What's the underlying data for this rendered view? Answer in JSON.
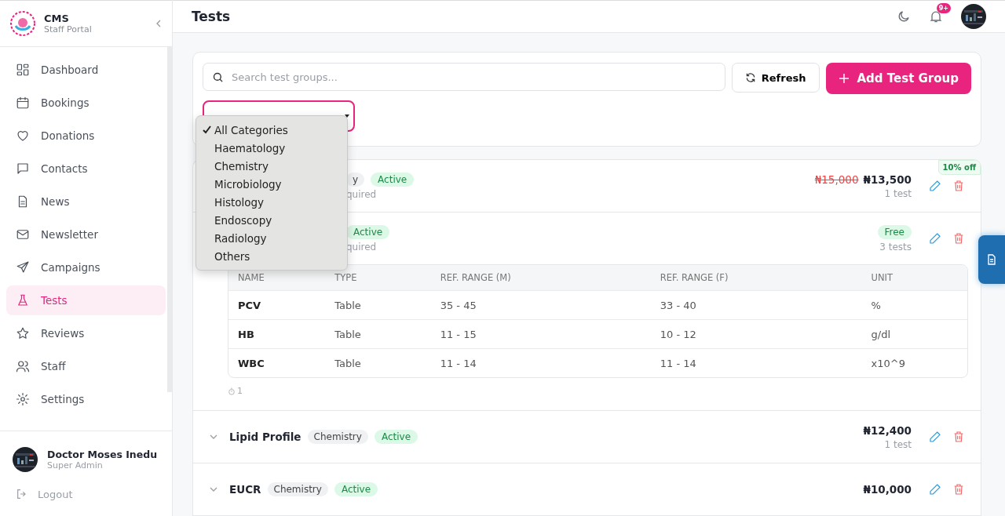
{
  "sidebar": {
    "brand": {
      "title": "CMS",
      "subtitle": "Staff Portal"
    },
    "items": [
      {
        "label": "Dashboard",
        "selected": false
      },
      {
        "label": "Bookings",
        "selected": false
      },
      {
        "label": "Donations",
        "selected": false
      },
      {
        "label": "Contacts",
        "selected": false
      },
      {
        "label": "News",
        "selected": false
      },
      {
        "label": "Newsletter",
        "selected": false
      },
      {
        "label": "Campaigns",
        "selected": false
      },
      {
        "label": "Tests",
        "selected": true
      },
      {
        "label": "Reviews",
        "selected": false
      },
      {
        "label": "Staff",
        "selected": false
      },
      {
        "label": "Settings",
        "selected": false
      }
    ],
    "user": {
      "name": "Doctor Moses Inedu",
      "role": "Super Admin"
    },
    "logout": "Logout"
  },
  "header": {
    "title": "Tests",
    "notification_badge": "9+"
  },
  "toolbar": {
    "search_placeholder": "Search test groups...",
    "refresh": "Refresh",
    "add": "Add Test Group"
  },
  "category_dropdown": {
    "options": [
      {
        "label": "All Categories",
        "selected": true
      },
      {
        "label": "Haematology",
        "selected": false
      },
      {
        "label": "Chemistry",
        "selected": false
      },
      {
        "label": "Microbiology",
        "selected": false
      },
      {
        "label": "Histology",
        "selected": false
      },
      {
        "label": "Endoscopy",
        "selected": false
      },
      {
        "label": "Radiology",
        "selected": false
      },
      {
        "label": "Others",
        "selected": false
      }
    ]
  },
  "groups": [
    {
      "category": "y",
      "status": "Active",
      "subtitle": "quired",
      "old_price": "₦15,000",
      "price": "₦13,500",
      "discount": "10% off",
      "count": "1 test",
      "expanded": false
    },
    {
      "status": "Active",
      "subtitle": "quired",
      "price_badge": "Free",
      "count": "3 tests",
      "expanded": true,
      "table": {
        "columns": [
          "NAME",
          "TYPE",
          "REF. RANGE (M)",
          "REF. RANGE (F)",
          "UNIT"
        ],
        "rows": [
          [
            "PCV",
            "Table",
            "35 - 45",
            "33 - 40",
            "%"
          ],
          [
            "HB",
            "Table",
            "11 - 15",
            "10 - 12",
            "g/dl"
          ],
          [
            "WBC",
            "Table",
            "11 - 14",
            "11 - 14",
            "x10^9"
          ]
        ]
      },
      "footer": "1"
    },
    {
      "name": "Lipid Profile",
      "category": "Chemistry",
      "status": "Active",
      "price": "₦12,400",
      "count": "1 test",
      "expanded": false
    },
    {
      "name": "EUCR",
      "category": "Chemistry",
      "status": "Active",
      "price": "₦10,000",
      "expanded": false
    }
  ]
}
